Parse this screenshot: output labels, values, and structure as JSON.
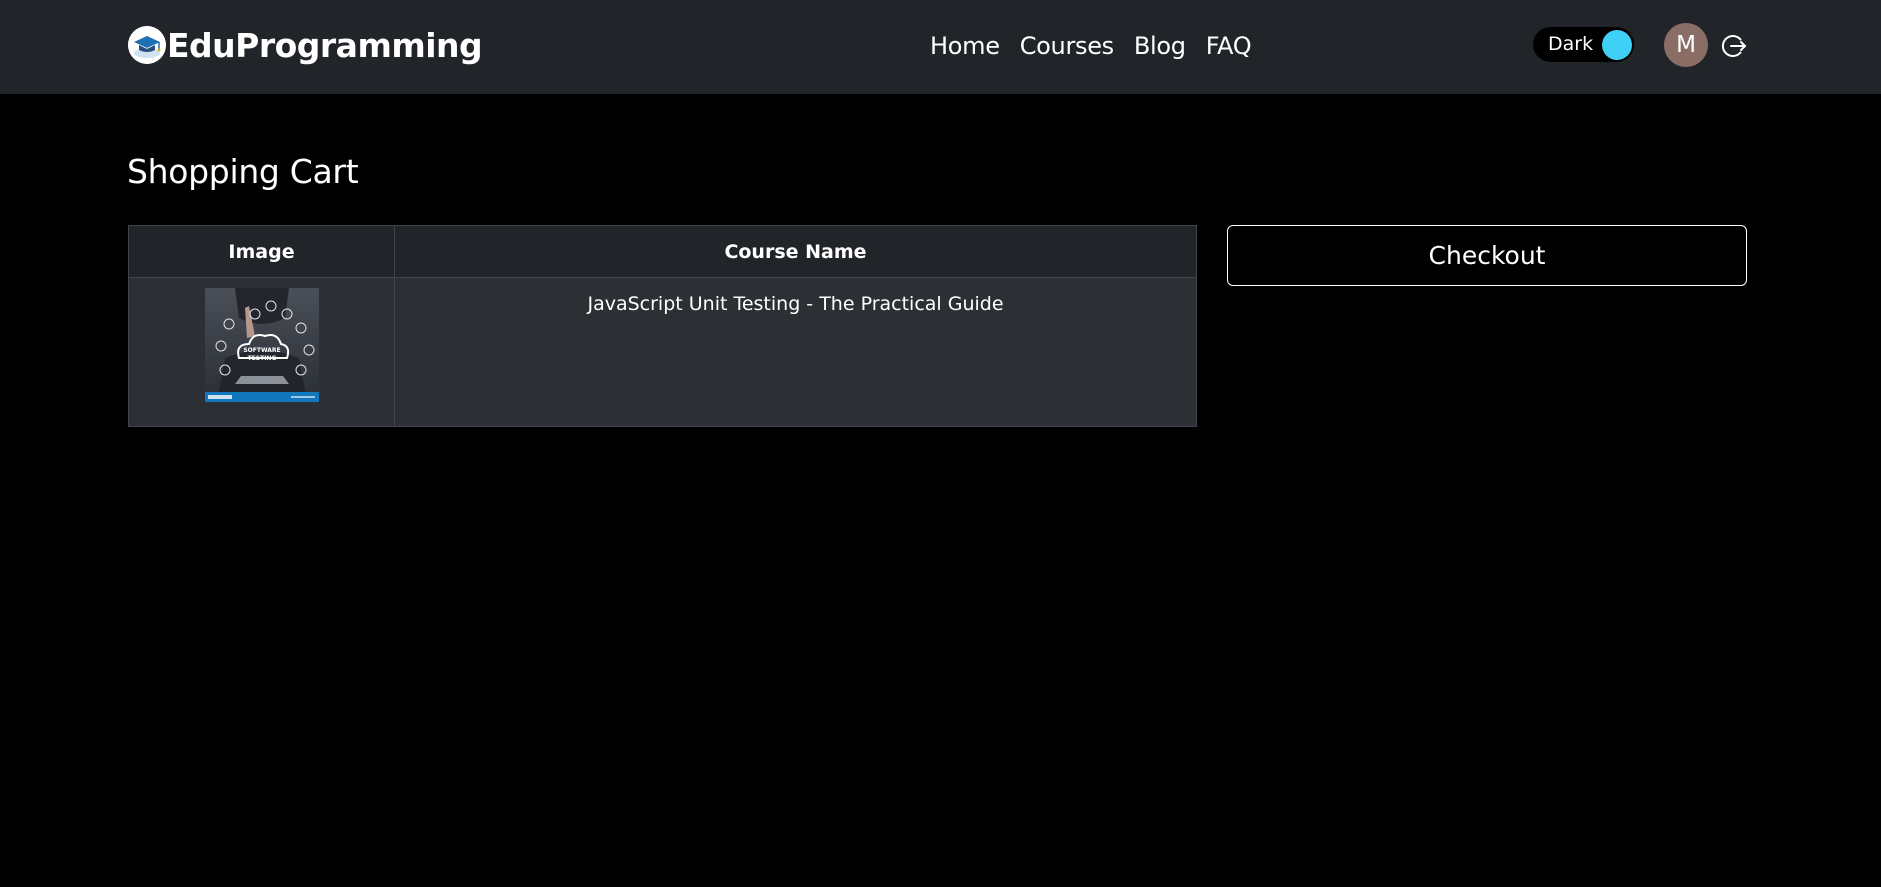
{
  "navbar": {
    "brand": "EduProgramming",
    "links": [
      "Home",
      "Courses",
      "Blog",
      "FAQ"
    ],
    "theme_toggle_label": "Dark",
    "avatar_initial": "M",
    "icons": {
      "logo": "graduation-cap-icon",
      "logout": "logout-icon"
    }
  },
  "main": {
    "title": "Shopping Cart",
    "table": {
      "headers": [
        "Image",
        "Course Name"
      ],
      "rows": [
        {
          "image_label": "SOFTWARE TESTING",
          "course_name": "JavaScript Unit Testing - The Practical Guide"
        }
      ]
    },
    "checkout_label": "Checkout"
  },
  "colors": {
    "navbar_bg": "#212529",
    "page_bg": "#000000",
    "toggle_knob": "#3ed1f5",
    "avatar_bg": "#8a6e66",
    "table_header_bg": "#212529",
    "table_row_bg": "#2c3034"
  }
}
